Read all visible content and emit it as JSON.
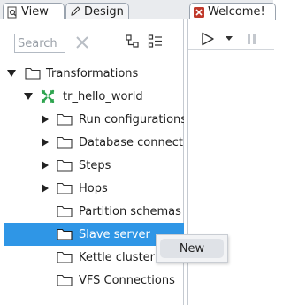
{
  "tabs": {
    "view": "View",
    "design": "Design",
    "welcome": "Welcome!"
  },
  "search": {
    "placeholder": "Search"
  },
  "icons": {
    "clear": "close-icon",
    "collapse": "collapse-all-icon",
    "expand": "expand-all-icon",
    "run": "run-icon",
    "run_options": "chevron-down-icon",
    "pause": "pause-icon"
  },
  "tree": {
    "root": "Transformations",
    "transformation": "tr_hello_world",
    "items": [
      "Run configurations",
      "Database connections",
      "Steps",
      "Hops",
      "Partition schemas",
      "Slave server",
      "Kettle cluster",
      "VFS Connections"
    ]
  },
  "context_menu": {
    "new": "New"
  },
  "colors": {
    "selection": "#2f96e6",
    "tab_bar": "#e9ebee",
    "welcome_icon": "#c0392b",
    "transformation_icon": "#2ea44f"
  }
}
